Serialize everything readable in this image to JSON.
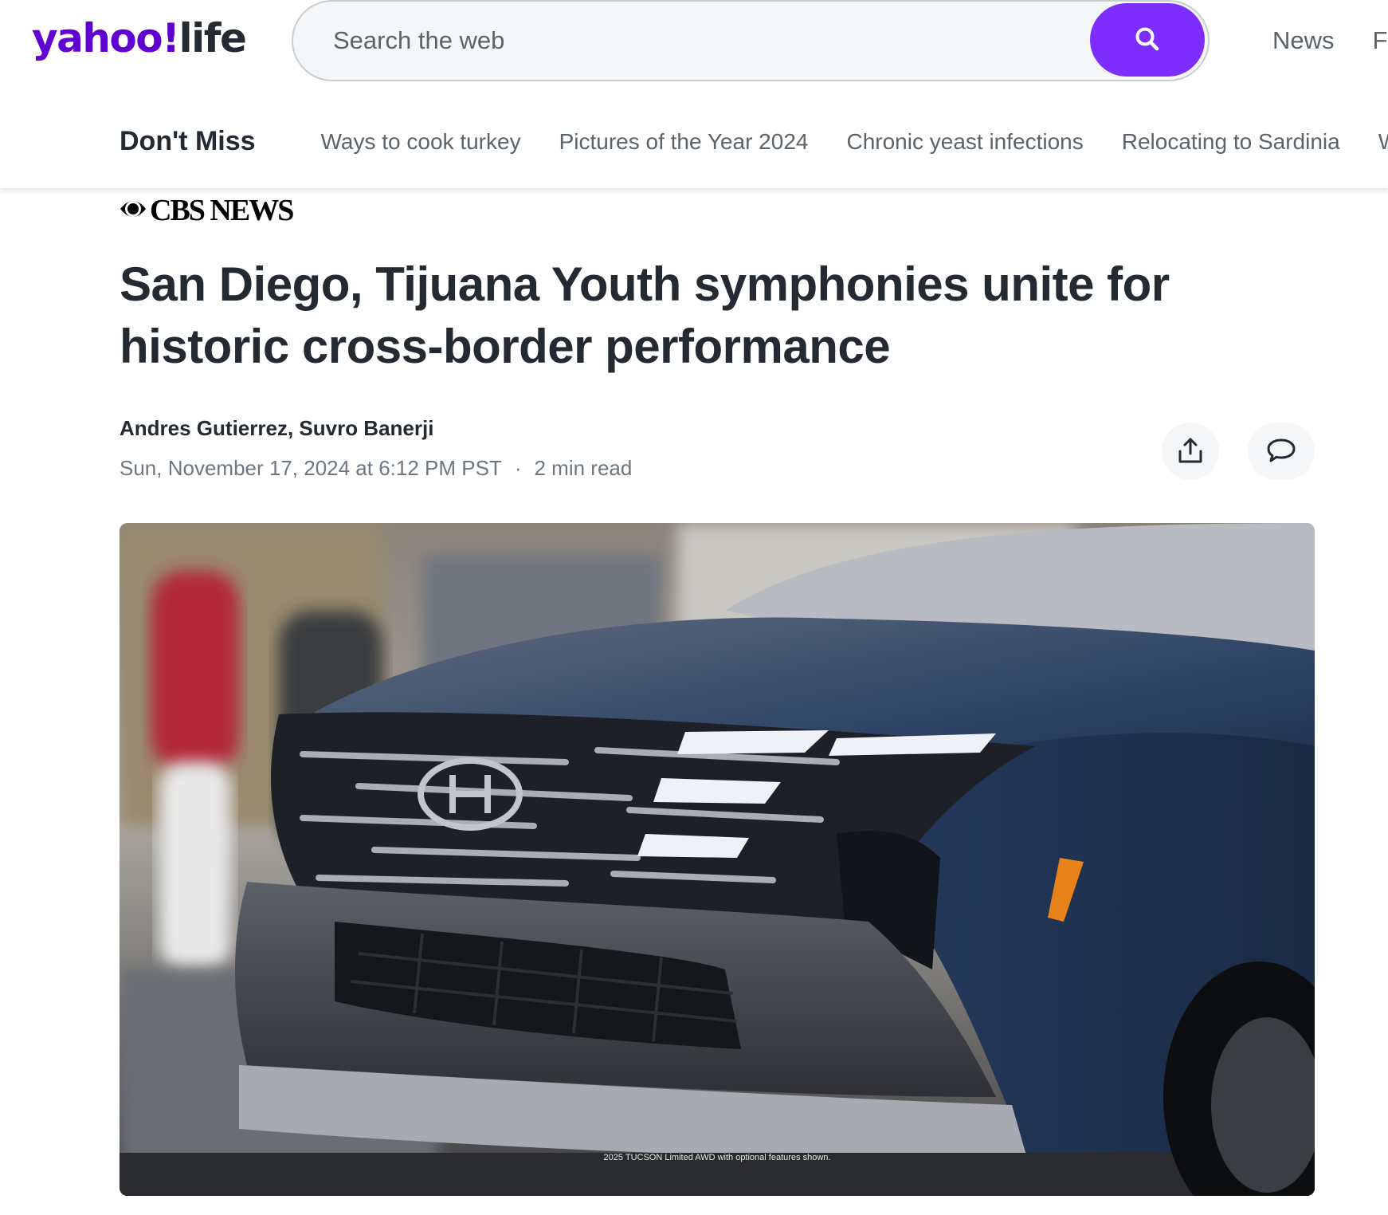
{
  "header": {
    "logo_brand": "yahoo",
    "logo_slash": "!",
    "logo_section": "life",
    "search_placeholder": "Search the web",
    "search_button_icon": "search-icon",
    "nav_items": [
      "News",
      "F"
    ]
  },
  "sub_nav": {
    "title": "Don't Miss",
    "links": [
      "Ways to cook turkey",
      "Pictures of the Year 2024",
      "Chronic yeast infections",
      "Relocating to Sardinia",
      "W"
    ]
  },
  "article": {
    "publisher": "CBS NEWS",
    "headline": "San Diego, Tijuana Youth symphonies unite for historic cross-border performance",
    "authors": "Andres Gutierrez, Suvro Banerji",
    "date": "Sun, November 17, 2024 at 6:12 PM PST",
    "separator": "·",
    "read_time": "2 min read",
    "share_icon": "share-icon",
    "comment_icon": "comment-icon",
    "hero_caption": "2025 TUCSON Limited AWD with optional features shown."
  },
  "colors": {
    "brand_purple": "#6001d2",
    "search_button": "#7d2eff",
    "text_primary": "#232a31",
    "text_secondary": "#5b636a"
  }
}
